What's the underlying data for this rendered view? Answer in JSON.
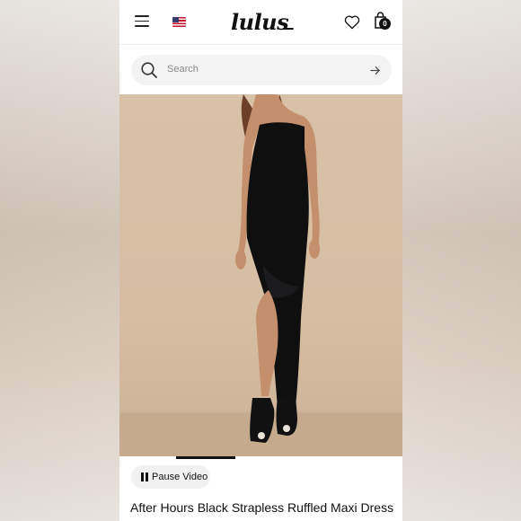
{
  "header": {
    "logo_text": "lulus",
    "menu_icon": "hamburger-menu-icon",
    "flag_icon": "us-flag-icon",
    "wishlist_icon": "heart-icon",
    "bag_icon": "shopping-bag-icon",
    "bag_count": "0"
  },
  "search": {
    "placeholder": "Search",
    "search_icon": "search-icon",
    "submit_icon": "arrow-right-icon"
  },
  "media": {
    "video_progress": 0.41,
    "pause_label": "Pause Video",
    "pause_icon": "pause-icon"
  },
  "product": {
    "title": "After Hours Black Strapless Ruffled Maxi Dress"
  },
  "colors": {
    "accent": "#111111",
    "search_bg": "#f3f3f3",
    "backdrop": "#d8c1a7",
    "dress": "#0f0f10"
  }
}
